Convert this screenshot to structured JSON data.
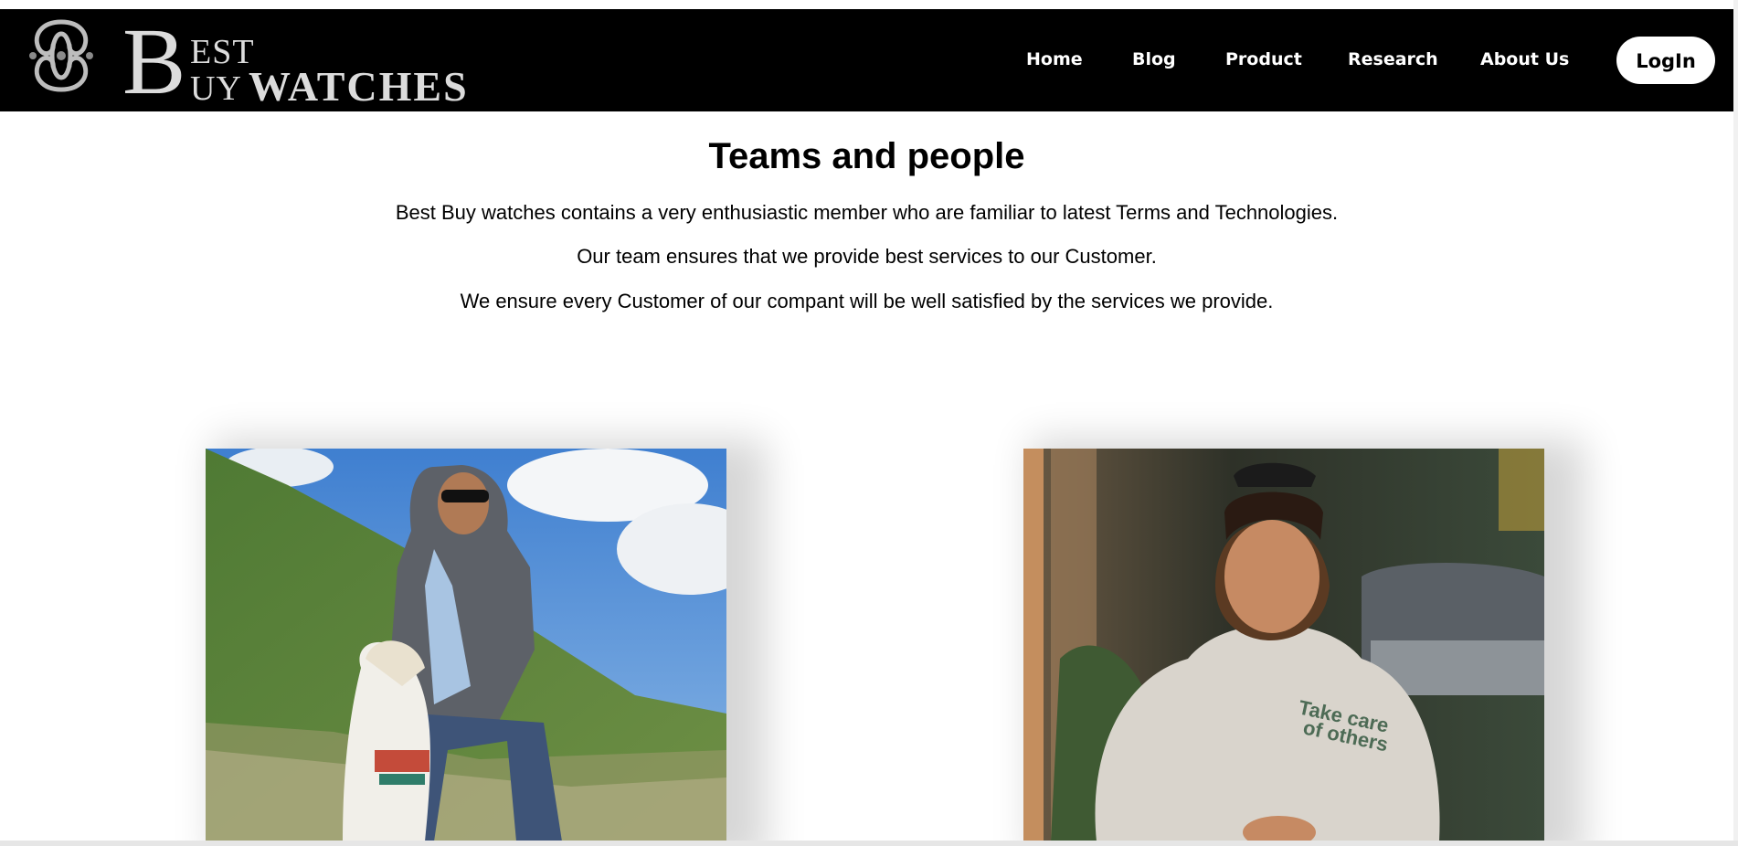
{
  "header": {
    "logo": {
      "text_big_letter": "B",
      "text_est": "EST",
      "text_uy": "UY",
      "text_watches": "WATCHES",
      "icon": "ornament-logo-icon"
    },
    "nav": [
      {
        "label": "Home"
      },
      {
        "label": "Blog"
      },
      {
        "label": "Product"
      },
      {
        "label": "Research"
      },
      {
        "label": "About Us"
      }
    ],
    "login_label": "LogIn"
  },
  "main": {
    "title": "Teams and people",
    "paragraphs": [
      "Best Buy watches contains a very enthusiastic member who are familiar to latest Terms and Technologies.",
      "Our team ensures that we provide best services to our Customer.",
      "We ensure every Customer of our compant will be well satisfied by the services we provide."
    ],
    "team_photos": [
      {
        "subject": "man-on-horse-photo"
      },
      {
        "subject": "woman-in-hoodie-photo",
        "shirt_text_1": "Take care",
        "shirt_text_2": "of others"
      }
    ]
  },
  "colors": {
    "navbar_bg": "#000000",
    "nav_text": "#ffffff",
    "login_bg": "#ffffff",
    "page_bg": "#ffffff"
  }
}
